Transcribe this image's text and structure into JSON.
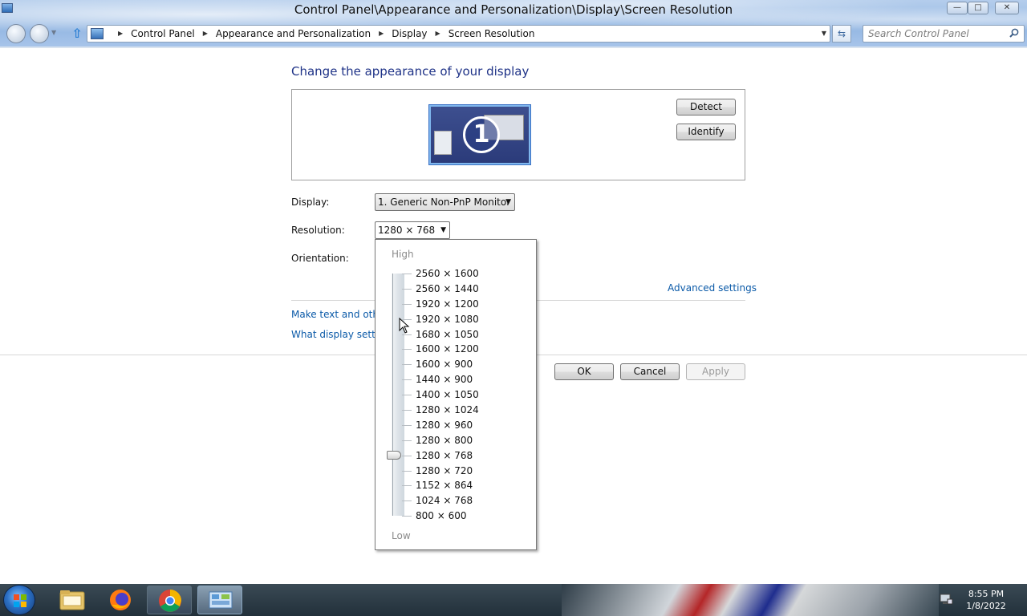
{
  "window": {
    "title": "Control Panel\\Appearance and Personalization\\Display\\Screen Resolution",
    "controls": {
      "minimize": "—",
      "maximize": "□",
      "close": "✕"
    }
  },
  "address_bar": {
    "crumbs": [
      "Control Panel",
      "Appearance and Personalization",
      "Display",
      "Screen Resolution"
    ]
  },
  "search": {
    "placeholder": "Search Control Panel"
  },
  "main": {
    "heading": "Change the appearance of your display",
    "monitor_number": "1",
    "detect_label": "Detect",
    "identify_label": "Identify",
    "display_label": "Display:",
    "display_value": "1. Generic Non-PnP Monitor",
    "resolution_label": "Resolution:",
    "resolution_value": "1280 × 768",
    "orientation_label": "Orientation:",
    "advanced_link": "Advanced settings",
    "text_size_link": "Make text and other",
    "what_settings_link": "What display setting",
    "ok_label": "OK",
    "cancel_label": "Cancel",
    "apply_label": "Apply"
  },
  "resolution_popup": {
    "high_label": "High",
    "low_label": "Low",
    "options": [
      "2560 × 1600",
      "2560 × 1440",
      "1920 × 1200",
      "1920 × 1080",
      "1680 × 1050",
      "1600 × 1200",
      "1600 × 900",
      "1440 × 900",
      "1400 × 1050",
      "1280 × 1024",
      "1280 × 960",
      "1280 × 800",
      "1280 × 768",
      "1280 × 720",
      "1152 × 864",
      "1024 × 768",
      "800 × 600"
    ],
    "selected": "1280 × 768"
  },
  "taskbar": {
    "pinned": [
      "windows-explorer",
      "firefox",
      "chrome",
      "control-panel"
    ],
    "clock_time": "8:55 PM",
    "clock_date": "1/8/2022"
  }
}
